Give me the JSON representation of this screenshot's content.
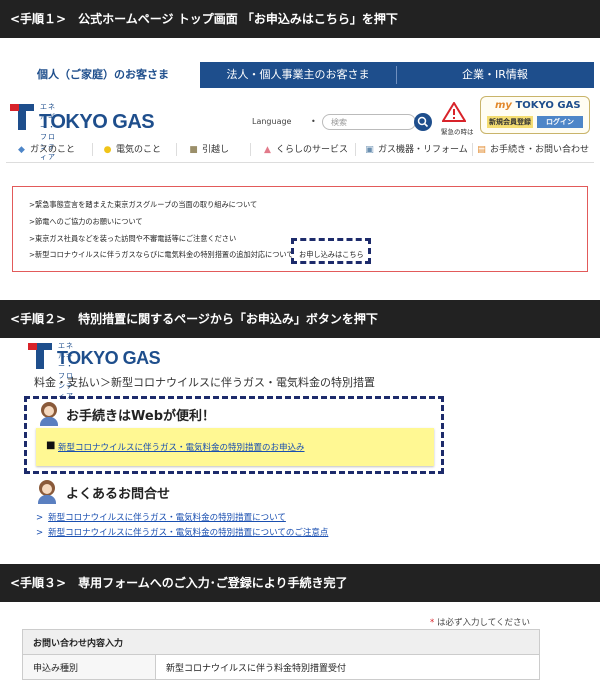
{
  "step1": {
    "label": "<手順１>　公式ホームページ トップ画面 「お申込みはこちら」を押下",
    "tabs": [
      "個人（ご家庭）のお客さま",
      "法人・個人事業主のお客さま",
      "企業・IR情報"
    ],
    "logo_sub": "エネルギー・フロンティア",
    "logo_main": "TOKYO GAS",
    "language_label": "Language",
    "search_placeholder": "検索",
    "emergency_label": "緊急の時は",
    "mytg_label_my": "my",
    "mytg_label": "TOKYO GAS",
    "register_label": "新規会員登録",
    "login_label": "ログイン",
    "nav": [
      {
        "icon": "flame-icon",
        "label": "ガスのこと"
      },
      {
        "icon": "lightbulb-icon",
        "label": "電気のこと"
      },
      {
        "icon": "truck-icon",
        "label": "引越し"
      },
      {
        "icon": "house-icon",
        "label": "くらしのサービス"
      },
      {
        "icon": "appliance-icon",
        "label": "ガス機器・リフォーム"
      },
      {
        "icon": "document-icon",
        "label": "お手続き・お問い合わせ"
      }
    ],
    "notices": [
      ">緊急事態宣言を踏まえた東京ガスグループの当面の取り組みについて",
      ">節電へのご協力のお願いについて",
      ">東京ガス社員などを装った訪問や不審電話等にご注意ください",
      ">新型コロナウイルスに伴うガスならびに電気料金の特別措置の追加対応について"
    ],
    "apply_link": "お申し込みはこちら"
  },
  "step2": {
    "label": "<手順２>　特別措置に関するページから「お申込み」ボタンを押下",
    "logo_sub": "エネルギー・フロンティア",
    "logo_main": "TOKYO GAS",
    "breadcrumb": "料金・支払い＞新型コロナウイルスに伴うガス・電気料金の特別措置",
    "web_heading": "お手続きはWebが便利！",
    "apply_bullet": "■",
    "apply_link": "新型コロナウイルスに伴うガス・電気料金の特別措置のお申込み",
    "faq_heading": "よくあるお問合せ",
    "faq_items": [
      "新型コロナウイルスに伴うガス・電気料金の特別措置について",
      "新型コロナウイルスに伴うガス・電気料金の特別措置についてのご注意点"
    ]
  },
  "step3": {
    "label": "<手順３>　専用フォームへのご入力･ご登録により手続き完了",
    "required_mark": "*",
    "required_note": "は必ず入力してください",
    "section_header": "お問い合わせ内容入力",
    "row_label": "申込み種別",
    "row_value": "新型コロナウイルスに伴う料金特別措置受付"
  },
  "colors": {
    "brand_blue": "#1e4e8c",
    "brand_red": "#d8232a",
    "dash": "#1d2b6b",
    "highlight": "#fff893"
  }
}
